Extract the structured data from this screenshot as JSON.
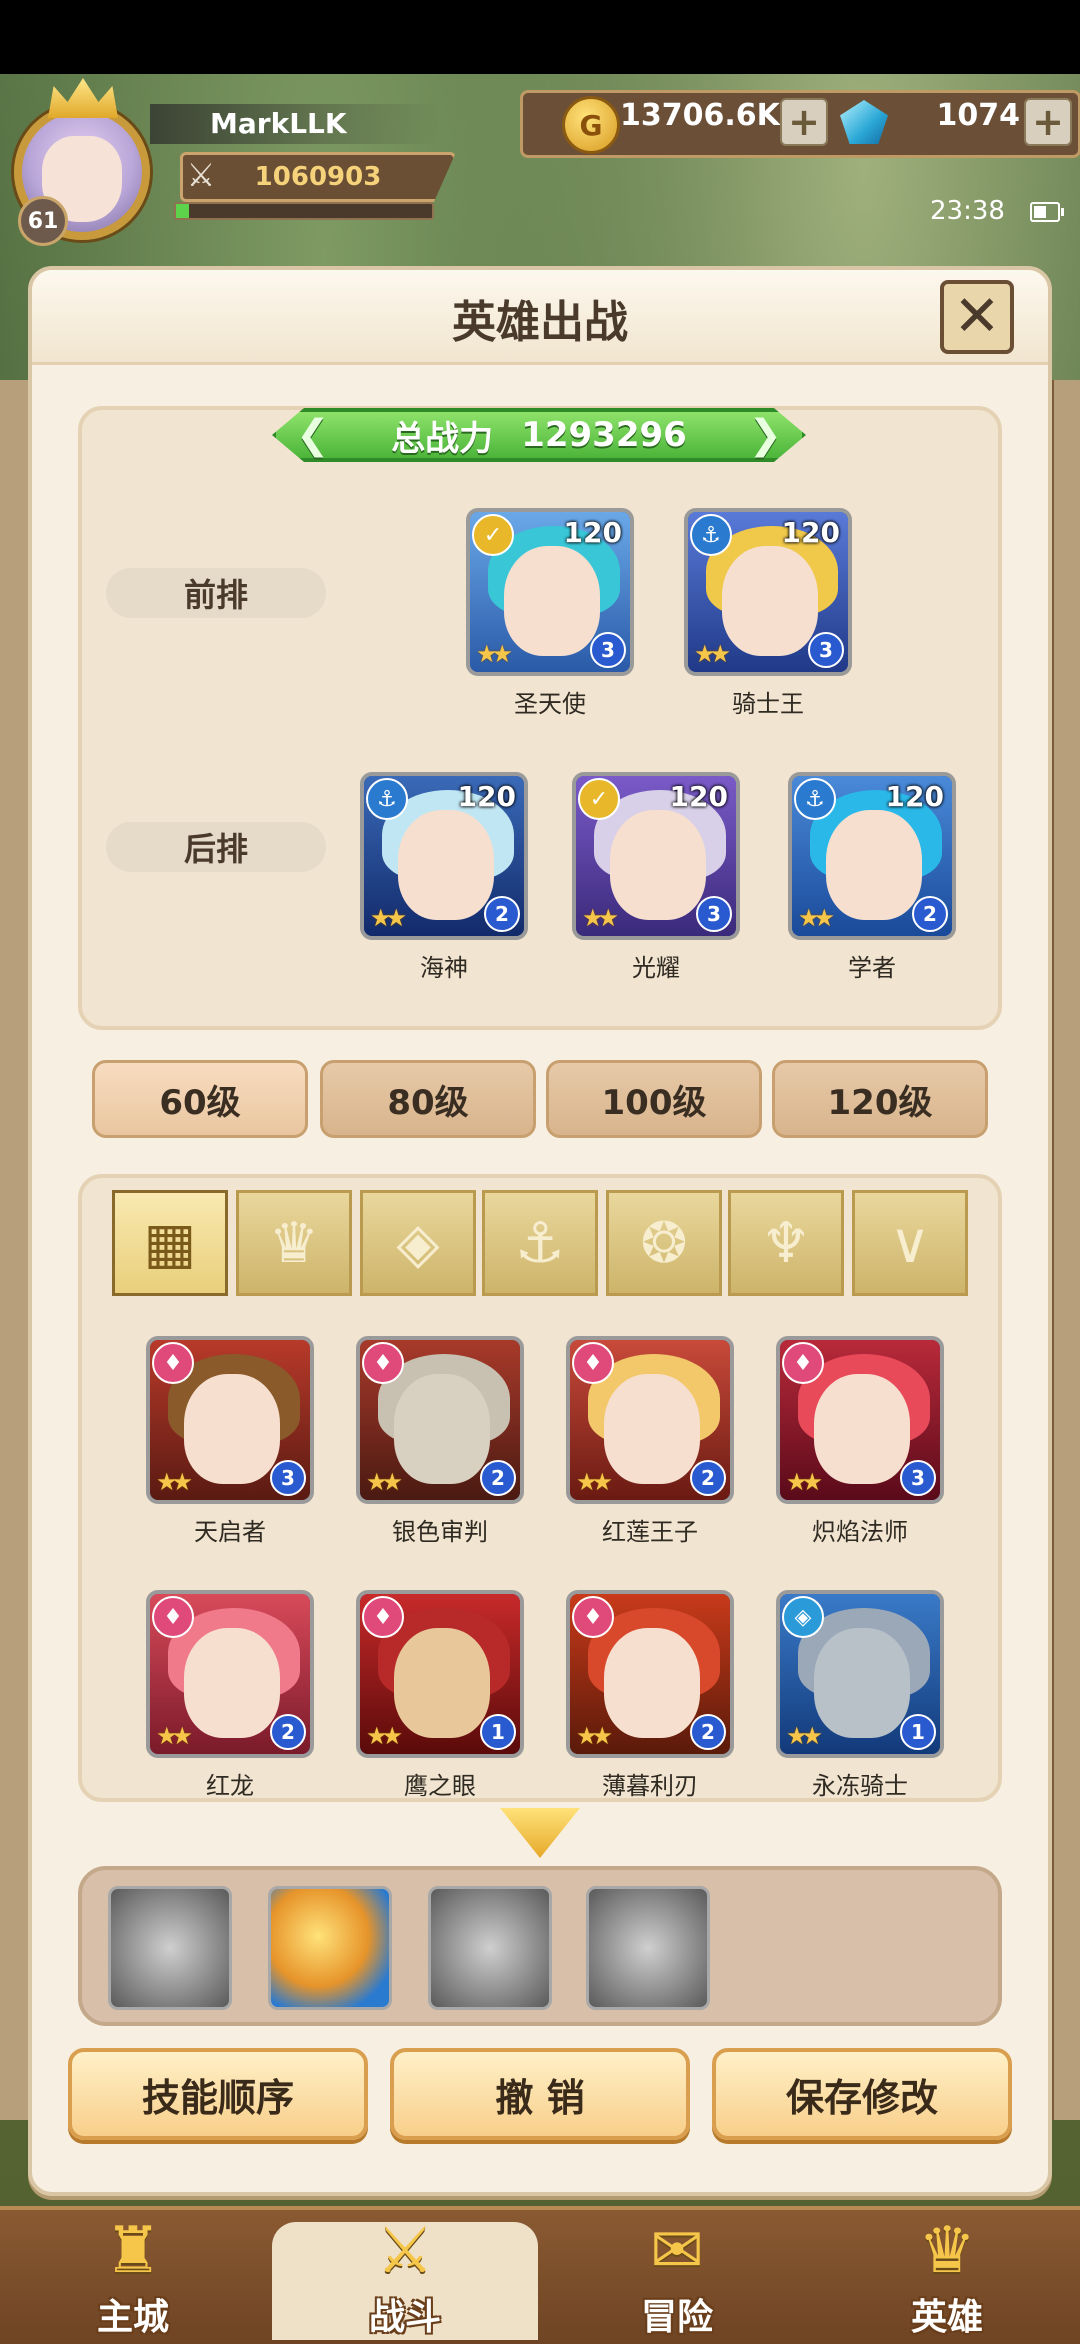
{
  "player": {
    "name": "MarkLLK",
    "level": "61",
    "power": "1060903",
    "exp_fraction": 0.05
  },
  "currency": {
    "gold": "13706.6K",
    "gems": "1074"
  },
  "status": {
    "time": "23:38"
  },
  "dialog": {
    "title": "英雄出战",
    "total_power_label": "总战力",
    "total_power_value": "1293296",
    "front_row_label": "前排",
    "back_row_label": "后排",
    "front_row": [
      {
        "name": "圣天使",
        "level": "120",
        "rank": "3",
        "class": "gold-badge"
      },
      {
        "name": "骑士王",
        "level": "120",
        "rank": "3",
        "class": "anchor-badge"
      }
    ],
    "back_row": [
      {
        "name": "海神",
        "level": "120",
        "rank": "2",
        "class": "anchor-badge"
      },
      {
        "name": "光耀",
        "level": "120",
        "rank": "3",
        "class": "gold-badge"
      },
      {
        "name": "学者",
        "level": "120",
        "rank": "2",
        "class": "anchor-badge"
      }
    ]
  },
  "level_filters": [
    "60级",
    "80级",
    "100级",
    "120级"
  ],
  "class_tabs": [
    "grid-icon",
    "crown-icon",
    "diamond-icon",
    "anchor-icon",
    "beast-icon",
    "wolf-icon",
    "horn-icon"
  ],
  "roster": [
    {
      "name": "天启者",
      "rank": "3"
    },
    {
      "name": "银色审判",
      "rank": "2"
    },
    {
      "name": "红莲王子",
      "rank": "2"
    },
    {
      "name": "炽焰法师",
      "rank": "3"
    },
    {
      "name": "红龙",
      "rank": "2"
    },
    {
      "name": "鹰之眼",
      "rank": "1"
    },
    {
      "name": "薄暮利刃",
      "rank": "2"
    },
    {
      "name": "永冻骑士",
      "rank": "1"
    }
  ],
  "actions": {
    "skill_order": "技能顺序",
    "undo": "撤 销",
    "save": "保存修改"
  },
  "nav": {
    "home": "主城",
    "battle": "战斗",
    "adventure": "冒险",
    "heroes": "英雄"
  },
  "colors": {
    "dialog_bg": "#f7efe1",
    "total_power_green": "#4cb53a",
    "button_orange": "#f8cf8a",
    "badge_pink": "#e04a7a",
    "badge_blue": "#2a7ad0",
    "badge_gold": "#e8b82a"
  }
}
